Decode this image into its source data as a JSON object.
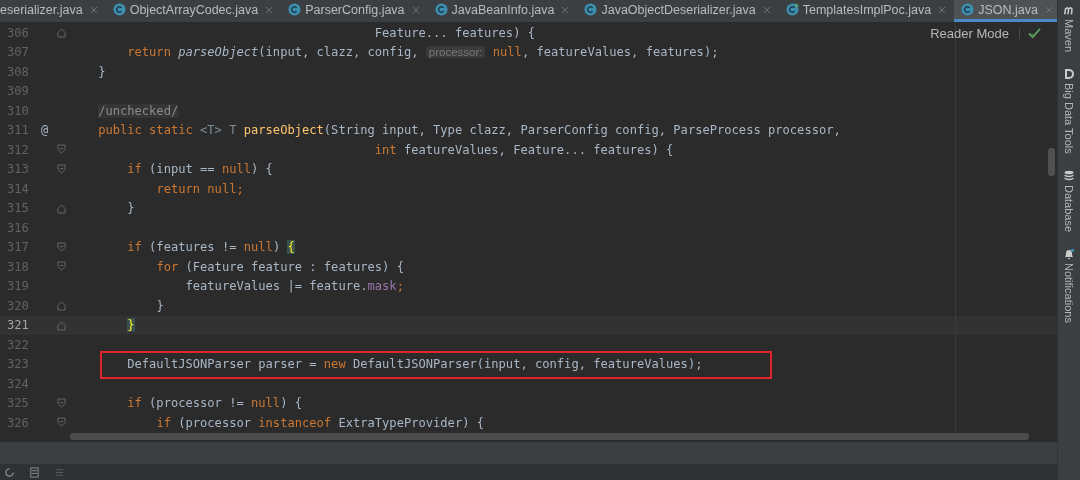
{
  "tabs": [
    {
      "label": "eserializer.java",
      "kind": "plain",
      "selected": false
    },
    {
      "label": "ObjectArrayCodec.java",
      "kind": "class",
      "selected": false
    },
    {
      "label": "ParserConfig.java",
      "kind": "class",
      "selected": false
    },
    {
      "label": "JavaBeanInfo.java",
      "kind": "class",
      "selected": false
    },
    {
      "label": "JavaObjectDeserializer.java",
      "kind": "class",
      "selected": false
    },
    {
      "label": "TemplatesImplPoc.java",
      "kind": "runnable",
      "selected": false
    },
    {
      "label": "JSON.java",
      "kind": "class",
      "selected": true
    }
  ],
  "reader_mode": "Reader Mode",
  "lines": [
    {
      "number": "306",
      "kind": "fold-end",
      "current": false,
      "boxed": false,
      "tokens": [
        {
          "t": "                                          Feature... features) {",
          "kind": "plain"
        }
      ]
    },
    {
      "number": "307",
      "kind": "plain",
      "current": false,
      "boxed": false,
      "tokens": [
        {
          "t": "        return",
          "kind": "keyword"
        },
        {
          "t": " parseObject",
          "kind": "call"
        },
        {
          "t": "(input, clazz, config, ",
          "kind": "plain"
        },
        {
          "t": "processor:",
          "kind": "hint"
        },
        {
          "t": " null",
          "kind": "keyword"
        },
        {
          "t": ", featureValues, features);",
          "kind": "plain"
        }
      ]
    },
    {
      "number": "308",
      "kind": "plain",
      "current": false,
      "boxed": false,
      "tokens": [
        {
          "t": "    }",
          "kind": "plain"
        }
      ]
    },
    {
      "number": "309",
      "kind": "plain",
      "current": false,
      "boxed": false
    },
    {
      "number": "310",
      "kind": "plain",
      "current": false,
      "boxed": false,
      "tokens": [
        {
          "t": "    /unchecked/",
          "kind": "comment"
        }
      ]
    },
    {
      "number": "311",
      "marker": "@",
      "kind": "plain",
      "current": false,
      "boxed": false,
      "tokens": [
        {
          "t": "    public static ",
          "kind": "keyword"
        },
        {
          "t": "<T> T ",
          "kind": "typeparam"
        },
        {
          "t": "parseObject",
          "kind": "declaration"
        },
        {
          "t": "(String input, Type clazz, ParserConfig config, ParseProcess processor,",
          "kind": "plain"
        }
      ]
    },
    {
      "number": "312",
      "kind": "fold-start",
      "current": false,
      "boxed": false,
      "tokens": [
        {
          "t": "                                          int",
          "kind": "keyword"
        },
        {
          "t": " featureValues, Feature... features) {",
          "kind": "plain"
        }
      ]
    },
    {
      "number": "313",
      "kind": "fold-start",
      "current": false,
      "boxed": false,
      "tokens": [
        {
          "t": "        if",
          "kind": "keyword"
        },
        {
          "t": " (input == ",
          "kind": "plain"
        },
        {
          "t": "null",
          "kind": "keyword"
        },
        {
          "t": ") {",
          "kind": "plain"
        }
      ]
    },
    {
      "number": "314",
      "kind": "plain",
      "current": false,
      "boxed": false,
      "tokens": [
        {
          "t": "            return null;",
          "kind": "keyword"
        }
      ]
    },
    {
      "number": "315",
      "kind": "fold-end",
      "current": false,
      "boxed": false,
      "tokens": [
        {
          "t": "        }",
          "kind": "plain"
        }
      ]
    },
    {
      "number": "316",
      "kind": "plain",
      "current": false,
      "boxed": false
    },
    {
      "number": "317",
      "kind": "fold-start",
      "current": false,
      "boxed": false,
      "tokens": [
        {
          "t": "        if",
          "kind": "keyword"
        },
        {
          "t": " (features != ",
          "kind": "plain"
        },
        {
          "t": "null",
          "kind": "keyword"
        },
        {
          "t": ") ",
          "kind": "plain"
        },
        {
          "t": "{",
          "kind": "match"
        }
      ]
    },
    {
      "number": "318",
      "kind": "fold-start",
      "current": false,
      "boxed": false,
      "tokens": [
        {
          "t": "            for",
          "kind": "keyword"
        },
        {
          "t": " (Feature feature : features) {",
          "kind": "plain"
        }
      ]
    },
    {
      "number": "319",
      "kind": "plain",
      "current": false,
      "boxed": false,
      "tokens": [
        {
          "t": "                featureValues |= feature.",
          "kind": "plain"
        },
        {
          "t": "mask",
          "kind": "field"
        },
        {
          "t": ";",
          "kind": "keyword"
        }
      ]
    },
    {
      "number": "320",
      "kind": "fold-end",
      "current": false,
      "boxed": false,
      "tokens": [
        {
          "t": "            }",
          "kind": "plain"
        }
      ]
    },
    {
      "number": "321",
      "kind": "fold-end",
      "current": true,
      "boxed": false,
      "tokens": [
        {
          "t": "        }",
          "kind": "match"
        }
      ]
    },
    {
      "number": "322",
      "kind": "plain",
      "current": false,
      "boxed": false
    },
    {
      "number": "323",
      "kind": "plain",
      "current": false,
      "boxed": true,
      "tokens": [
        {
          "t": "        DefaultJSONParser parser = ",
          "kind": "plain"
        },
        {
          "t": "new",
          "kind": "keyword"
        },
        {
          "t": " DefaultJSONParser(input, config, featureValues);",
          "kind": "plain"
        }
      ]
    },
    {
      "number": "324",
      "kind": "plain",
      "current": false,
      "boxed": false
    },
    {
      "number": "325",
      "kind": "fold-start",
      "current": false,
      "boxed": false,
      "tokens": [
        {
          "t": "        if",
          "kind": "keyword"
        },
        {
          "t": " (processor != ",
          "kind": "plain"
        },
        {
          "t": "null",
          "kind": "keyword"
        },
        {
          "t": ") {",
          "kind": "plain"
        }
      ]
    },
    {
      "number": "326",
      "kind": "fold-start",
      "current": false,
      "boxed": false,
      "tokens": [
        {
          "t": "            if",
          "kind": "keyword"
        },
        {
          "t": " (processor ",
          "kind": "plain"
        },
        {
          "t": "instanceof",
          "kind": "keyword"
        },
        {
          "t": " ExtraTypeProvider) {",
          "kind": "plain"
        }
      ]
    }
  ],
  "tool_windows": [
    {
      "label": "Maven",
      "kind": "maven"
    },
    {
      "label": "Big Data Tools",
      "kind": "bigdata"
    },
    {
      "label": "Database",
      "kind": "database"
    },
    {
      "label": "Notifications",
      "kind": "notifications"
    }
  ]
}
